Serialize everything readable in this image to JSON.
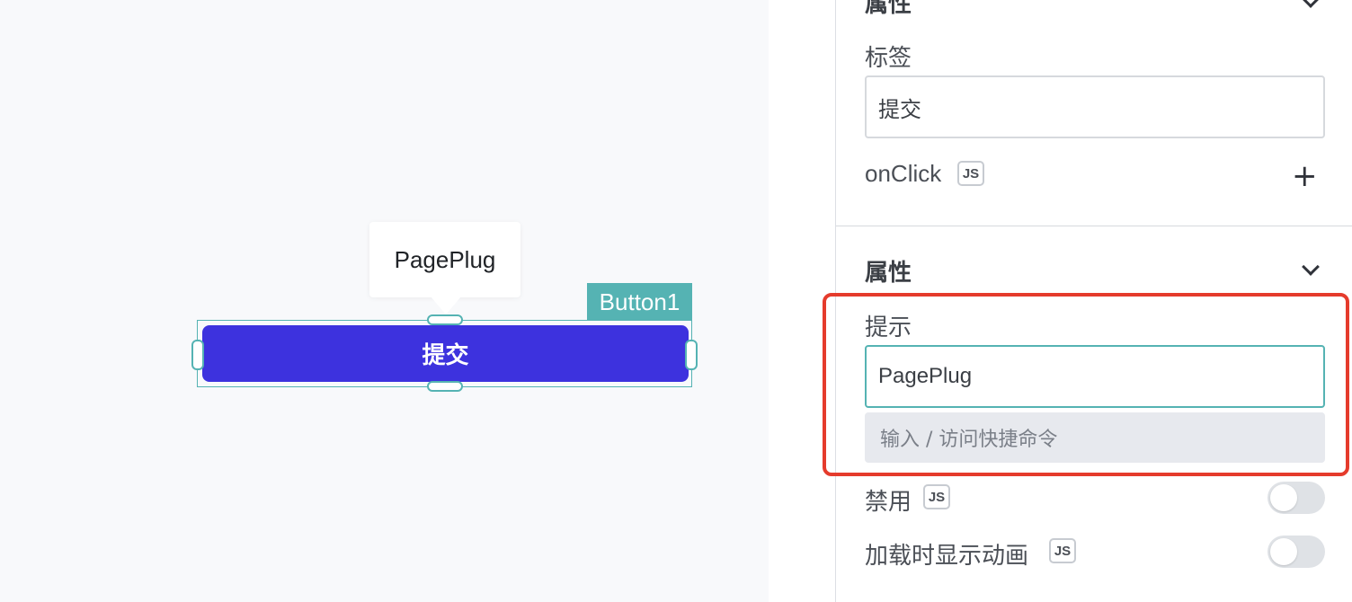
{
  "canvas": {
    "tooltip_text": "PagePlug",
    "widget_name": "Button1",
    "button_label": "提交"
  },
  "pane": {
    "top_section_title": "属性",
    "label_field": {
      "label": "标签",
      "value": "提交"
    },
    "onclick": {
      "label": "onClick",
      "js": "JS",
      "add": "+"
    },
    "properties_section": {
      "title": "属性"
    },
    "tooltip_field": {
      "label": "提示",
      "value": "PagePlug",
      "hint": "输入 / 访问快捷命令"
    },
    "disabled": {
      "label": "禁用",
      "js": "JS",
      "on": false
    },
    "animate_loading": {
      "label": "加载时显示动画",
      "js": "JS",
      "on": false
    }
  },
  "colors": {
    "button_bg": "#3d32de",
    "accent": "#55b3b3",
    "highlight": "#e53b2c"
  },
  "icons": [
    "chevron-down-icon",
    "plus-icon"
  ]
}
